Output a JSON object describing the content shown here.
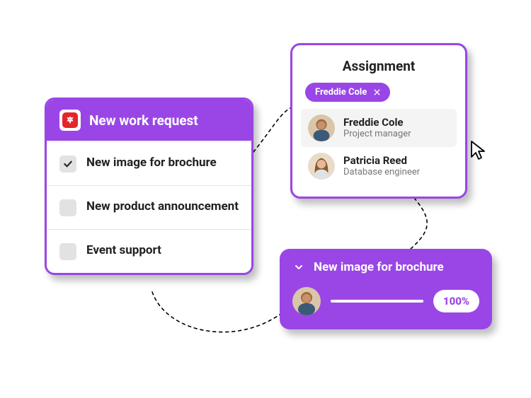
{
  "colors": {
    "accent": "#9a46e6",
    "brandRed": "#e4252a"
  },
  "work_request": {
    "title": "New work request",
    "items": [
      {
        "label": "New image for brochure",
        "checked": true
      },
      {
        "label": "New product announcement",
        "checked": false
      },
      {
        "label": "Event support",
        "checked": false
      }
    ]
  },
  "assignment": {
    "title": "Assignment",
    "chip": {
      "label": "Freddie Cole"
    },
    "people": [
      {
        "name": "Freddie Cole",
        "role": "Project manager",
        "selected": true
      },
      {
        "name": "Patricia Reed",
        "role": "Database engineer",
        "selected": false
      }
    ]
  },
  "progress": {
    "title": "New image for brochure",
    "percent_label": "100%",
    "percent_value": 100
  }
}
